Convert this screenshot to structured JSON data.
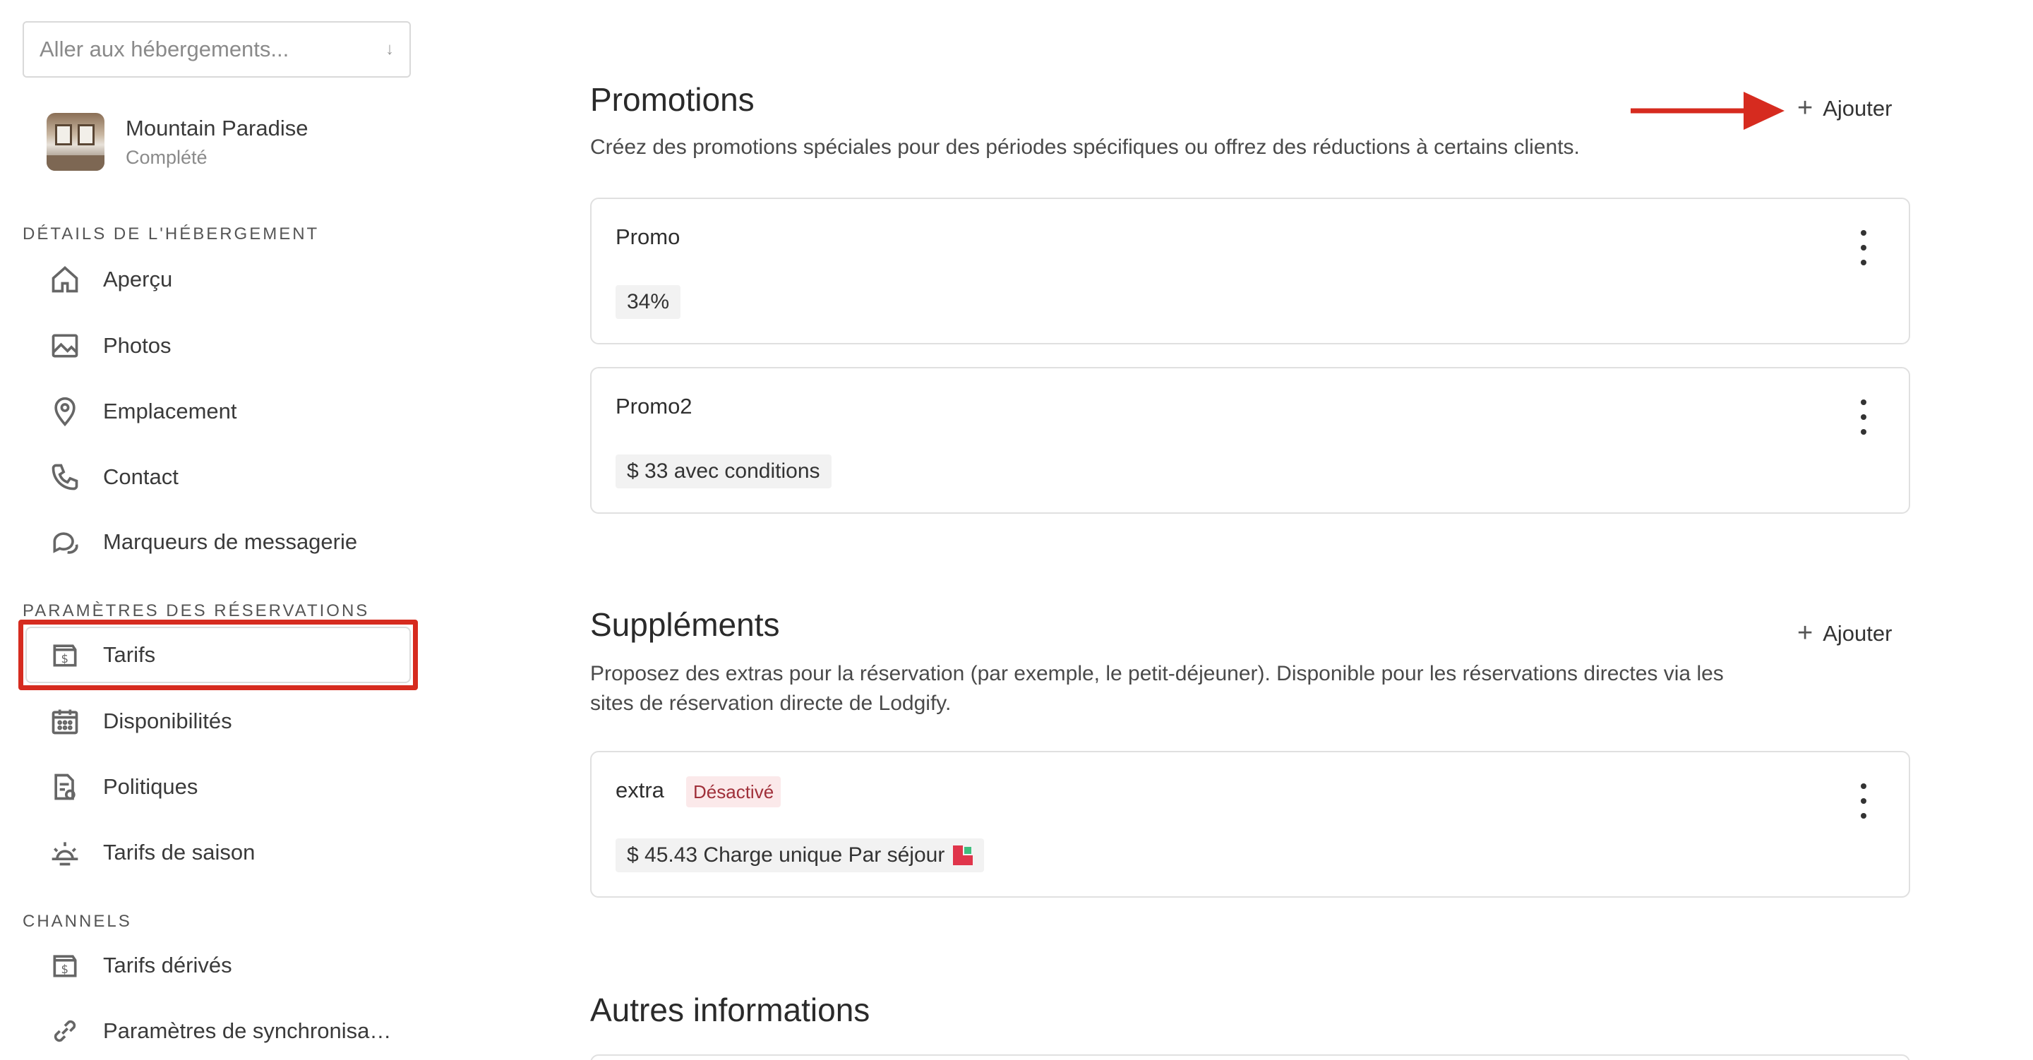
{
  "sidebar": {
    "search": {
      "placeholder": "Aller aux hébergements...",
      "arrow_icon": "arrow-down-icon"
    },
    "property": {
      "name": "Mountain Paradise",
      "status": "Complété"
    },
    "sections": [
      {
        "title": "DÉTAILS DE L'HÉBERGEMENT",
        "items": [
          {
            "label": "Aperçu",
            "icon": "home-icon"
          },
          {
            "label": "Photos",
            "icon": "image-icon"
          },
          {
            "label": "Emplacement",
            "icon": "location-pin-icon"
          },
          {
            "label": "Contact",
            "icon": "phone-icon"
          },
          {
            "label": "Marqueurs de messagerie",
            "icon": "chat-bubbles-icon"
          }
        ]
      },
      {
        "title": "PARAMÈTRES DES RÉSERVATIONS",
        "items": [
          {
            "label": "Tarifs",
            "icon": "price-tag-icon",
            "active": true
          },
          {
            "label": "Disponibilités",
            "icon": "calendar-icon"
          },
          {
            "label": "Politiques",
            "icon": "document-policy-icon"
          },
          {
            "label": "Tarifs de saison",
            "icon": "sun-icon"
          }
        ]
      },
      {
        "title": "CHANNELS",
        "items": [
          {
            "label": "Tarifs dérivés",
            "icon": "price-tag-icon"
          },
          {
            "label": "Paramètres de synchronisa…",
            "icon": "link-icon"
          }
        ]
      }
    ]
  },
  "main": {
    "promotions": {
      "title": "Promotions",
      "description": "Créez des promotions spéciales pour des périodes spécifiques ou offrez des réductions à certains clients.",
      "add_label": "Ajouter",
      "cards": [
        {
          "title": "Promo",
          "tag": "34%"
        },
        {
          "title": "Promo2",
          "tag": "$ 33 avec conditions"
        }
      ]
    },
    "supplements": {
      "title": "Suppléments",
      "description": "Proposez des extras pour la réservation (par exemple, le petit-déjeuner). Disponible pour les réservations directes via les sites de réservation directe de Lodgify.",
      "add_label": "Ajouter",
      "cards": [
        {
          "title": "extra",
          "badge": "Désactivé",
          "tag": "$ 45.43 Charge unique Par séjour",
          "tag_icon": "lodgify-flag-icon"
        }
      ]
    },
    "other": {
      "title": "Autres informations"
    }
  },
  "colors": {
    "highlight": "#d62b1f",
    "annotation_arrow": "#d62b1f",
    "badge_bg": "#fbe9ea",
    "badge_text": "#a0303a"
  }
}
